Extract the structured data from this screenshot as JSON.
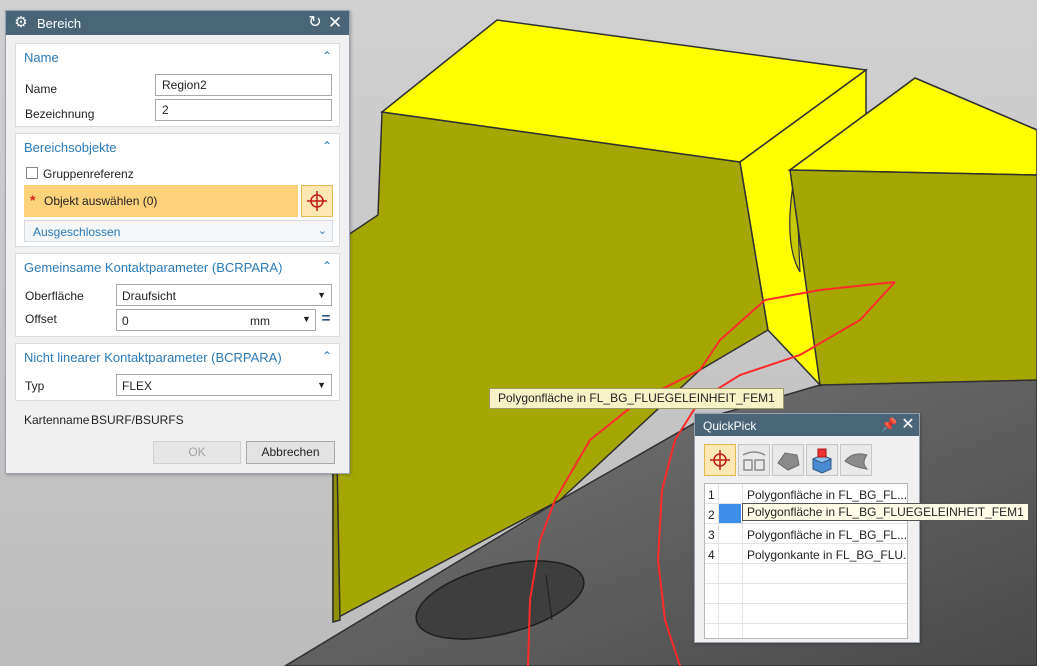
{
  "dialog": {
    "title": "Bereich",
    "sections": {
      "name": {
        "title": "Name",
        "name_label": "Name",
        "name_value": "Region2",
        "desc_label": "Bezeichnung",
        "desc_value": "2"
      },
      "objects": {
        "title": "Bereichsobjekte",
        "group_ref_label": "Gruppenreferenz",
        "group_ref_checked": false,
        "select_label": "Objekt auswählen (0)",
        "excluded_label": "Ausgeschlossen"
      },
      "contact": {
        "title": "Gemeinsame Kontaktparameter (BCRPARA)",
        "surface_label": "Oberfläche",
        "surface_value": "Draufsicht",
        "offset_label": "Offset",
        "offset_value": "0",
        "offset_unit": "mm"
      },
      "nonlinear": {
        "title": "Nicht linearer Kontaktparameter (BCRPARA)",
        "type_label": "Typ",
        "type_value": "FLEX"
      }
    },
    "card_label": "Kartenname",
    "card_value": "BSURF/BSURFS",
    "ok_label": "OK",
    "cancel_label": "Abbrechen"
  },
  "tooltip": "Polygonfläche in FL_BG_FLUEGELEINHEIT_FEM1",
  "quickpick": {
    "title": "QuickPick",
    "tools": [
      "crosshair-icon",
      "edges-icon",
      "mesh-face-icon",
      "solid-body-icon",
      "surface-icon"
    ],
    "rows": [
      {
        "num": "1",
        "text": "Polygonfläche in FL_BG_FL..."
      },
      {
        "num": "2",
        "text": "Polygonfläche in FL_BG_FLUEGELEINHEIT_FEM1",
        "selected": true
      },
      {
        "num": "3",
        "text": "Polygonfläche in FL_BG_FL..."
      },
      {
        "num": "4",
        "text": "Polygonkante in FL_BG_FLU..."
      }
    ]
  },
  "colors": {
    "titlebar": "#4a6577",
    "accent_blue": "#2a7ab8",
    "select_highlight": "#fdd27a",
    "model_yellow": "#ffff00",
    "model_olive": "#a6a600",
    "selection_red": "#ff2b2b"
  }
}
